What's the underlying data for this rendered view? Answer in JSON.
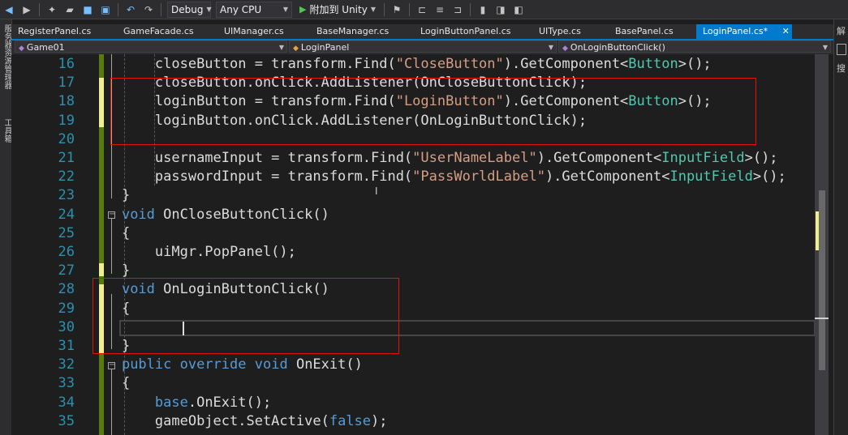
{
  "toolbar": {
    "config": "Debug",
    "platform": "Any CPU",
    "attach_label": "附加到 Unity",
    "icons": [
      "back-icon",
      "forward-icon",
      "new-project-icon",
      "open-file-icon",
      "save-icon",
      "save-all-icon",
      "undo-icon",
      "redo-icon",
      "attach-play-icon",
      "breakpoint-icon"
    ]
  },
  "left_strip": {
    "items": [
      "服务器资源管理器",
      "工具箱"
    ]
  },
  "right_strip": {
    "items": [
      "解",
      "搜"
    ]
  },
  "tabs": [
    {
      "label": "RegisterPanel.cs",
      "active": false
    },
    {
      "label": "GameFacade.cs",
      "active": false
    },
    {
      "label": "UIManager.cs",
      "active": false
    },
    {
      "label": "BaseManager.cs",
      "active": false
    },
    {
      "label": "LoginButtonPanel.cs",
      "active": false
    },
    {
      "label": "UIType.cs",
      "active": false
    },
    {
      "label": "BasePanel.cs",
      "active": false
    },
    {
      "label": "LoginPanel.cs*",
      "active": true
    }
  ],
  "navbar": {
    "project": "Game01",
    "class": "LoginPanel",
    "member": "OnLoginButtonClick()"
  },
  "code_lines": [
    {
      "num": "16",
      "indent": "    ",
      "tokens": [
        [
          "",
          "closeButton = transform.Find("
        ],
        [
          "st",
          "\"CloseButton\""
        ],
        [
          "",
          ").GetComponent<"
        ],
        [
          "ty",
          "Button"
        ],
        [
          "",
          ">();"
        ]
      ]
    },
    {
      "num": "17",
      "indent": "    ",
      "tokens": [
        [
          "",
          "closeButton.onClick.AddListener(OnCloseButtonClick);"
        ]
      ]
    },
    {
      "num": "18",
      "indent": "    ",
      "tokens": [
        [
          "",
          "loginButton = transform.Find("
        ],
        [
          "st",
          "\"LoginButton\""
        ],
        [
          "",
          ").GetComponent<"
        ],
        [
          "ty",
          "Button"
        ],
        [
          "",
          ">();"
        ]
      ]
    },
    {
      "num": "19",
      "indent": "    ",
      "tokens": [
        [
          "",
          "loginButton.onClick.AddListener(OnLoginButtonClick);"
        ]
      ]
    },
    {
      "num": "20",
      "indent": "",
      "tokens": []
    },
    {
      "num": "21",
      "indent": "    ",
      "tokens": [
        [
          "",
          "usernameInput = transform.Find("
        ],
        [
          "st",
          "\"UserNameLabel\""
        ],
        [
          "",
          ").GetComponent<"
        ],
        [
          "ty",
          "InputField"
        ],
        [
          "",
          ">();"
        ]
      ]
    },
    {
      "num": "22",
      "indent": "    ",
      "tokens": [
        [
          "",
          "passwordInput = transform.Find("
        ],
        [
          "st",
          "\"PassWorldLabel\""
        ],
        [
          "",
          ").GetComponent<"
        ],
        [
          "ty",
          "InputField"
        ],
        [
          "",
          ">();"
        ]
      ]
    },
    {
      "num": "23",
      "indent": "",
      "tokens": [
        [
          "",
          "}"
        ]
      ]
    },
    {
      "num": "24",
      "indent": "",
      "tokens": [
        [
          "kw",
          "void"
        ],
        [
          "",
          " OnCloseButtonClick()"
        ]
      ]
    },
    {
      "num": "25",
      "indent": "",
      "tokens": [
        [
          "",
          "{"
        ]
      ]
    },
    {
      "num": "26",
      "indent": "    ",
      "tokens": [
        [
          "",
          "uiMgr.PopPanel();"
        ]
      ]
    },
    {
      "num": "27",
      "indent": "",
      "tokens": [
        [
          "",
          "}"
        ]
      ]
    },
    {
      "num": "28",
      "indent": "",
      "tokens": [
        [
          "kw",
          "void"
        ],
        [
          "",
          " OnLoginButtonClick()"
        ]
      ]
    },
    {
      "num": "29",
      "indent": "",
      "tokens": [
        [
          "",
          "{"
        ]
      ]
    },
    {
      "num": "30",
      "indent": "",
      "tokens": []
    },
    {
      "num": "31",
      "indent": "",
      "tokens": [
        [
          "",
          "}"
        ]
      ]
    },
    {
      "num": "32",
      "indent": "",
      "tokens": [
        [
          "kw",
          "public"
        ],
        [
          "",
          " "
        ],
        [
          "kw",
          "override"
        ],
        [
          "",
          " "
        ],
        [
          "kw",
          "void"
        ],
        [
          "",
          " OnExit()"
        ]
      ]
    },
    {
      "num": "33",
      "indent": "",
      "tokens": [
        [
          "",
          "{"
        ]
      ]
    },
    {
      "num": "34",
      "indent": "    ",
      "tokens": [
        [
          "kw",
          "base"
        ],
        [
          "",
          ".OnExit();"
        ]
      ]
    },
    {
      "num": "35",
      "indent": "    ",
      "tokens": [
        [
          "",
          "gameObject.SetActive("
        ],
        [
          "kw",
          "false"
        ],
        [
          "",
          ");"
        ]
      ]
    }
  ]
}
